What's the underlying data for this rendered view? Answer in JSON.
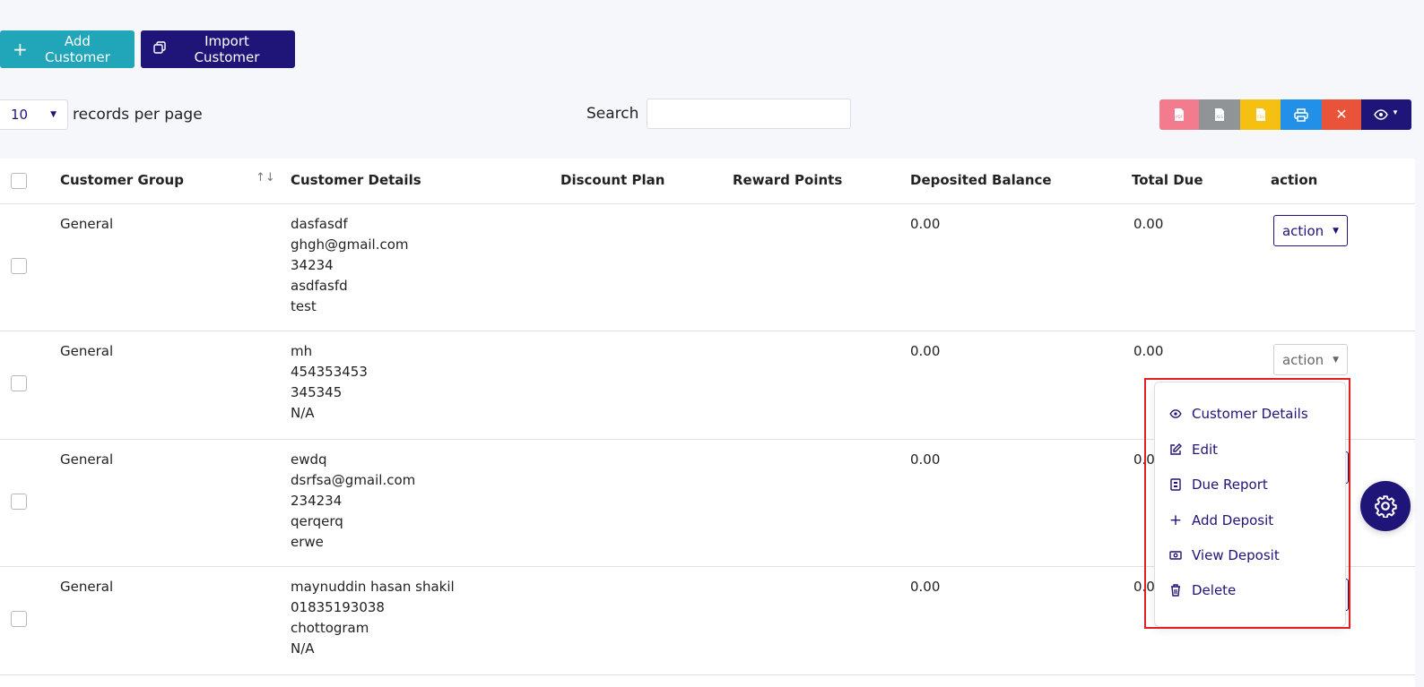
{
  "toolbar": {
    "add_customer_label": "Add Customer",
    "import_customer_label": "Import Customer"
  },
  "controls": {
    "per_page_value": "10",
    "records_label": "records per page",
    "search_label": "Search",
    "search_value": ""
  },
  "export_buttons": [
    "pdf",
    "xls",
    "csv",
    "print",
    "close",
    "column-visibility"
  ],
  "table": {
    "headers": {
      "group": "Customer Group",
      "details": "Customer Details",
      "discount": "Discount Plan",
      "reward": "Reward Points",
      "deposit": "Deposited Balance",
      "due": "Total Due",
      "action": "action"
    },
    "rows": [
      {
        "group": "General",
        "details": [
          "dasfasdf",
          "ghgh@gmail.com",
          "34234",
          "asdfasfd",
          "test"
        ],
        "deposit": "0.00",
        "due": "0.00",
        "action": "action"
      },
      {
        "group": "General",
        "details": [
          "mh",
          "454353453",
          "345345",
          "N/A"
        ],
        "deposit": "0.00",
        "due": "0.00",
        "action": "action"
      },
      {
        "group": "General",
        "details": [
          "ewdq",
          "dsrfsa@gmail.com",
          "234234",
          "qerqerq",
          "erwe"
        ],
        "deposit": "0.00",
        "due": "0.0",
        "action": "action"
      },
      {
        "group": "General",
        "details": [
          "maynuddin hasan shakil",
          "01835193038",
          "chottogram",
          "N/A"
        ],
        "deposit": "0.00",
        "due": "0.0",
        "action": "action"
      }
    ]
  },
  "dropdown": {
    "items": [
      {
        "label": "Customer Details",
        "icon": "eye-icon"
      },
      {
        "label": "Edit",
        "icon": "edit-icon"
      },
      {
        "label": "Due Report",
        "icon": "report-icon"
      },
      {
        "label": "Add Deposit",
        "icon": "plus-icon"
      },
      {
        "label": "View Deposit",
        "icon": "money-icon"
      },
      {
        "label": "Delete",
        "icon": "trash-icon"
      }
    ]
  },
  "colors": {
    "primary": "#1f1477",
    "teal": "#20a6b8",
    "highlight": "#e02020"
  }
}
